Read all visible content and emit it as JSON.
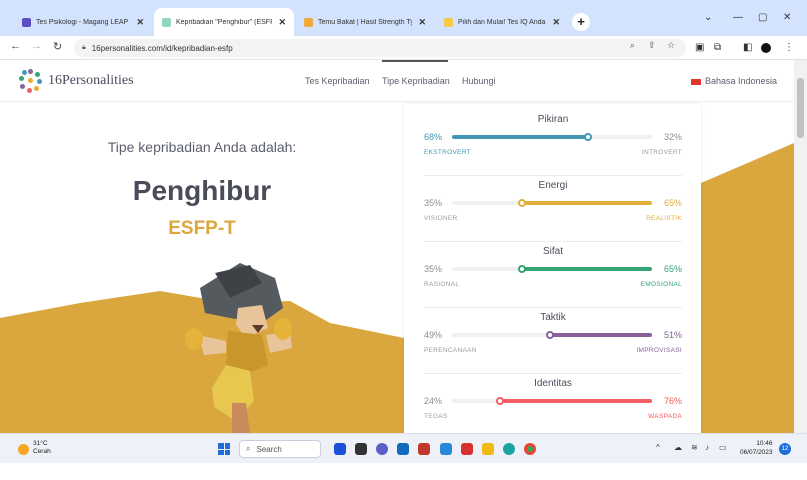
{
  "browser": {
    "tabs": [
      {
        "title": "Tes Psikologi - Magang LEAP E",
        "favicon_color": "#5b4fc4",
        "active": false
      },
      {
        "title": "Kepribadian \"Penghibur\" (ESFP",
        "favicon_color": "#8fd6c3",
        "active": true
      },
      {
        "title": "Temu Bakat | Hasil Strength Typ",
        "favicon_color": "#f2a93b",
        "active": false
      },
      {
        "title": "Pilih dan Mulai! Tes IQ Anda de",
        "favicon_color": "#f7c948",
        "active": false
      }
    ],
    "new_tab": "+",
    "url": "16personalities.com/id/kepribadian-esfp"
  },
  "site": {
    "logo_text": "16Personalities",
    "nav": [
      "Tes Kepribadian",
      "Tipe Kepribadian",
      "Hubungi"
    ],
    "language": "Bahasa Indonesia"
  },
  "hero": {
    "title": "Tipe kepribadian Anda adalah:",
    "type_name": "Penghibur",
    "type_code": "ESFP-T"
  },
  "traits": [
    {
      "name": "Pikiran",
      "left_pct": "68%",
      "right_pct": "32%",
      "left_label": "EKSTROVERT",
      "right_label": "INTROVERT",
      "dominant": "left",
      "value": 0.68,
      "color": "#4298b4"
    },
    {
      "name": "Energi",
      "left_pct": "35%",
      "right_pct": "65%",
      "left_label": "VISIONER",
      "right_label": "REALISTIK",
      "dominant": "right",
      "value": 0.65,
      "color": "#e4ae3a"
    },
    {
      "name": "Sifat",
      "left_pct": "35%",
      "right_pct": "65%",
      "left_label": "RASIONAL",
      "right_label": "EMOSIONAL",
      "dominant": "right",
      "value": 0.65,
      "color": "#33a474"
    },
    {
      "name": "Taktik",
      "left_pct": "49%",
      "right_pct": "51%",
      "left_label": "PERENCANAAN",
      "right_label": "IMPROVISASI",
      "dominant": "right",
      "value": 0.51,
      "color": "#88619a"
    },
    {
      "name": "Identitas",
      "left_pct": "24%",
      "right_pct": "76%",
      "left_label": "TEGAS",
      "right_label": "WASPADA",
      "dominant": "right",
      "value": 0.76,
      "color": "#f25e62"
    }
  ],
  "taskbar": {
    "weather_temp": "31°C",
    "weather_desc": "Cerah",
    "search": "Search",
    "time": "10:46",
    "date": "06/07/2023",
    "notifications": "12"
  },
  "colors": {
    "accent_gold": "#d9a73d",
    "tab_strip": "#d3e3fd"
  }
}
